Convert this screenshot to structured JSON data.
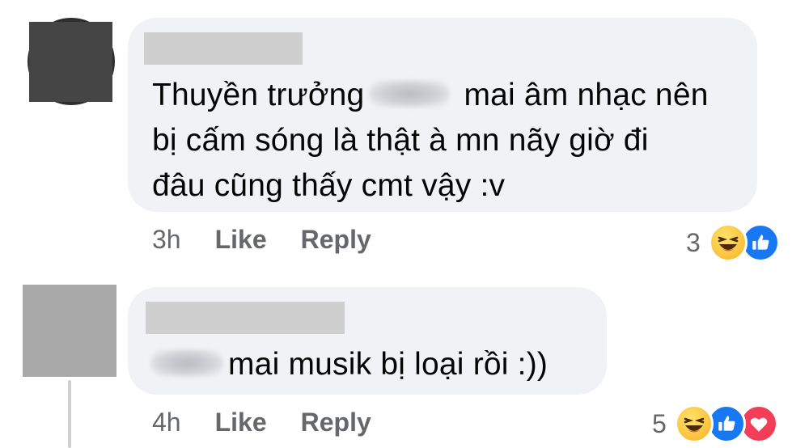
{
  "comments": [
    {
      "text_before": "Thuyền trưởng",
      "text_after": " mai âm nhạc nên",
      "text_line2": "bị cấm sóng là thật à mn nãy giờ đi",
      "text_line3": "đâu cũng thấy cmt vậy :v",
      "time": "3h",
      "like_label": "Like",
      "reply_label": "Reply",
      "reaction_count": "3",
      "reactions": [
        "haha-icon",
        "like-icon"
      ]
    },
    {
      "text_after": "mai musik bị loại rồi :))",
      "time": "4h",
      "like_label": "Like",
      "reply_label": "Reply",
      "reaction_count": "5",
      "reactions": [
        "haha-icon",
        "like-icon",
        "love-icon"
      ]
    }
  ],
  "colors": {
    "bubble": "#f0f2f5",
    "meta": "#65676b",
    "like_blue": "#1877f2",
    "love_red": "#f33e58",
    "haha_yellow": "#f7b125"
  }
}
